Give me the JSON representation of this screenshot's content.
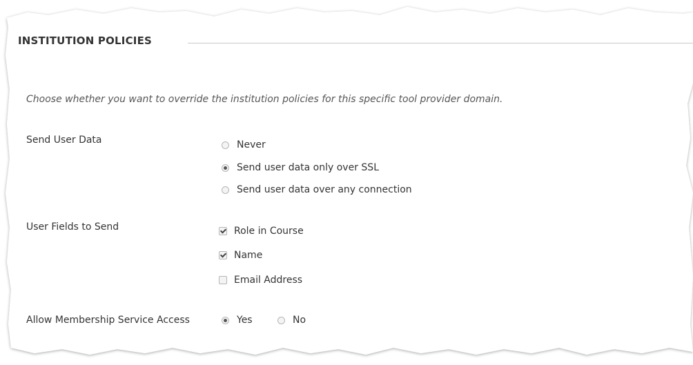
{
  "section": {
    "title": "INSTITUTION POLICIES"
  },
  "instructions": "Choose whether you want to override the institution policies for this specific tool provider domain.",
  "send_user_data": {
    "label": "Send User Data",
    "options": [
      {
        "label": "Never",
        "selected": false
      },
      {
        "label": "Send user data only over SSL",
        "selected": true
      },
      {
        "label": "Send user data over any connection",
        "selected": false
      }
    ]
  },
  "user_fields": {
    "label": "User Fields to Send",
    "options": [
      {
        "label": "Role in Course",
        "checked": true
      },
      {
        "label": "Name",
        "checked": true
      },
      {
        "label": "Email Address",
        "checked": false
      }
    ]
  },
  "membership": {
    "label": "Allow Membership Service Access",
    "options": [
      {
        "label": "Yes",
        "selected": true
      },
      {
        "label": "No",
        "selected": false
      }
    ]
  }
}
